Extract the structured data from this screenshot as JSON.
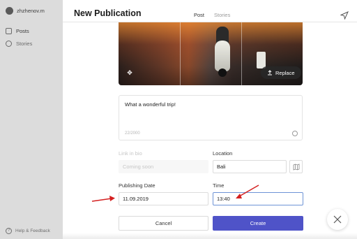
{
  "sidebar": {
    "username": "zhzhenov.m",
    "items": [
      {
        "label": "Posts",
        "icon": "image-icon"
      },
      {
        "label": "Stories",
        "icon": "plus-circle-icon"
      }
    ],
    "help_label": "Help & Feedback"
  },
  "modal": {
    "title": "New Publication",
    "tabs": [
      {
        "label": "Post",
        "active": true
      },
      {
        "label": "Stories",
        "active": false
      }
    ]
  },
  "photo": {
    "replace_label": "Replace"
  },
  "caption": {
    "text": "What a wonderful trip!",
    "counter": "22/2000"
  },
  "link_in_bio": {
    "label": "Link in bio",
    "placeholder": "Coming soon"
  },
  "location": {
    "label": "Location",
    "value": "Bali"
  },
  "publishing_date": {
    "label": "Publishing Date",
    "value": "11.09.2019"
  },
  "time": {
    "label": "Time",
    "value": "13:40"
  },
  "buttons": {
    "cancel": "Cancel",
    "create": "Create"
  },
  "colors": {
    "accent": "#4f53c8",
    "annotation_arrow": "#d42020"
  }
}
